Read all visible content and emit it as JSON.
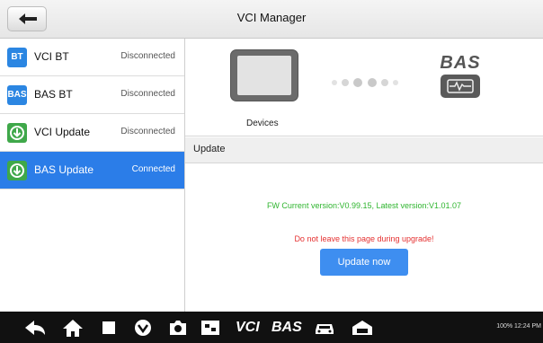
{
  "header": {
    "title": "VCI Manager"
  },
  "sidebar": {
    "items": [
      {
        "icon_text": "BT",
        "icon": "bluetooth-badge-icon",
        "label": "VCI BT",
        "status": "Disconnected",
        "active": false
      },
      {
        "icon_text": "BAS",
        "icon": "bas-badge-icon",
        "label": "BAS BT",
        "status": "Disconnected",
        "active": false
      },
      {
        "icon_text": "",
        "icon": "download-icon",
        "label": "VCI Update",
        "status": "Disconnected",
        "active": false
      },
      {
        "icon_text": "",
        "icon": "download-icon",
        "label": "BAS Update",
        "status": "Connected",
        "active": true
      }
    ]
  },
  "main": {
    "devices_label": "Devices",
    "bas_logo_text": "BAS",
    "update": {
      "title": "Update",
      "fw_version": "FW Current version:V0.99.15, Latest version:V1.01.07",
      "warning": "Do not leave this page during upgrade!",
      "button_label": "Update now"
    }
  },
  "taskbar": {
    "vci_label": "VCI",
    "bas_label": "BAS",
    "status_text": "100% 12:24 PM"
  },
  "colors": {
    "accent": "#2b7de8",
    "ok_green": "#2fb52f",
    "warning_red": "#e53131"
  }
}
